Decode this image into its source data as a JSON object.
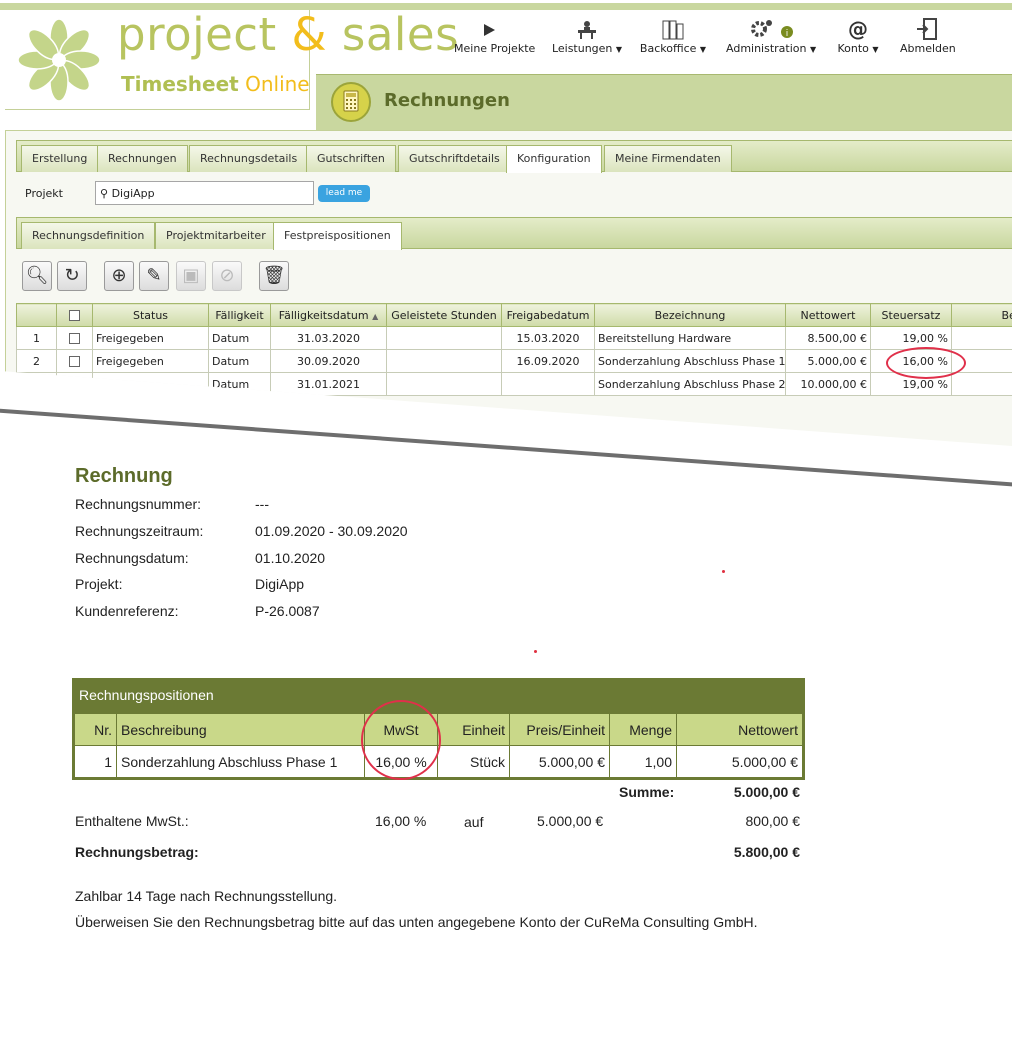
{
  "app": {
    "brand_main": "project ",
    "brand_amp": "&",
    "brand_end": " sales",
    "sub_a": "Timesheet",
    "sub_b": " Online",
    "page_title": "Rechnungen"
  },
  "nav": [
    {
      "label": "Meine Projekte",
      "arrow": "",
      "icon": "play-icon"
    },
    {
      "label": "Leistungen",
      "arrow": "▼",
      "icon": "desk-icon"
    },
    {
      "label": "Backoffice",
      "arrow": "▼",
      "icon": "folders-icon"
    },
    {
      "label": "Administration",
      "arrow": "▼",
      "icon": "gears-icon"
    },
    {
      "label": "Konto",
      "arrow": "▼",
      "icon": "at-icon"
    },
    {
      "label": "Abmelden",
      "arrow": "",
      "icon": "exit-icon"
    }
  ],
  "tabs_main": [
    "Erstellung",
    "Rechnungen",
    "Rechnungsdetails",
    "Gutschriften",
    "Gutschriftdetails",
    "Konfiguration",
    "Meine Firmendaten"
  ],
  "tabs_main_active": "Konfiguration",
  "project": {
    "label": "Projekt",
    "value": "DigiApp",
    "button": "lead me"
  },
  "tabs_sub": [
    "Rechnungsdefinition",
    "Projektmitarbeiter",
    "Festpreispositionen"
  ],
  "tabs_sub_active": "Festpreispositionen",
  "toolbar_icons": [
    "search-icon",
    "refresh-icon",
    "add-icon",
    "edit-icon",
    "save-icon",
    "cancel-icon",
    "delete-icon"
  ],
  "grid": {
    "columns": [
      "",
      "",
      "Status",
      "Fälligkeit",
      "Fälligkeitsdatum",
      "Geleistete Stunden",
      "Freigabedatum",
      "Bezeichnung",
      "Nettowert",
      "Steuersatz",
      "Bem"
    ],
    "rows": [
      {
        "nr": "1",
        "status": "Freigegeben",
        "faelligkeit": "Datum",
        "datum": "31.03.2020",
        "stunden": "",
        "freigabe": "15.03.2020",
        "bezeichnung": "Bereitstellung Hardware",
        "netto": "8.500,00 €",
        "steuer": "19,00 %"
      },
      {
        "nr": "2",
        "status": "Freigegeben",
        "faelligkeit": "Datum",
        "datum": "30.09.2020",
        "stunden": "",
        "freigabe": "16.09.2020",
        "bezeichnung": "Sonderzahlung Abschluss Phase 1",
        "netto": "5.000,00 €",
        "steuer": "16,00 %"
      },
      {
        "nr": "",
        "status": "",
        "faelligkeit": "Datum",
        "datum": "31.01.2021",
        "stunden": "",
        "freigabe": "",
        "bezeichnung": "Sonderzahlung Abschluss Phase 2",
        "netto": "10.000,00 €",
        "steuer": "19,00 %"
      }
    ]
  },
  "invoice": {
    "title": "Rechnung",
    "fields": [
      {
        "label": "Rechnungsnummer:",
        "value": "---"
      },
      {
        "label": "Rechnungszeitraum:",
        "value": "01.09.2020 - 30.09.2020"
      },
      {
        "label": "Rechnungsdatum:",
        "value": "01.10.2020"
      },
      {
        "label": "Projekt:",
        "value": "DigiApp"
      },
      {
        "label": "Kundenreferenz:",
        "value": "P-26.0087"
      }
    ],
    "positions_title": "Rechnungspositionen",
    "positions_headers": [
      "Nr.",
      "Beschreibung",
      "MwSt",
      "Einheit",
      "Preis/Einheit",
      "Menge",
      "Nettowert"
    ],
    "positions": [
      {
        "nr": "1",
        "beschreibung": "Sonderzahlung Abschluss Phase 1",
        "mwst": "16,00 %",
        "einheit": "Stück",
        "preis": "5.000,00 €",
        "menge": "1,00",
        "netto": "5.000,00 €"
      }
    ],
    "summe_label": "Summe:",
    "summe": "5.000,00 €",
    "mwst_label": "Enthaltene MwSt.:",
    "mwst_rate": "16,00 %",
    "mwst_auf": "auf",
    "mwst_basis": "5.000,00 €",
    "mwst_betrag": "800,00 €",
    "betrag_label": "Rechnungsbetrag:",
    "betrag": "5.800,00 €",
    "note1": "Zahlbar 14 Tage nach Rechnungsstellung.",
    "note2": "Überweisen Sie den Rechnungsbetrag bitte auf das unten angegebene Konto der CuReMa Consulting GmbH."
  }
}
